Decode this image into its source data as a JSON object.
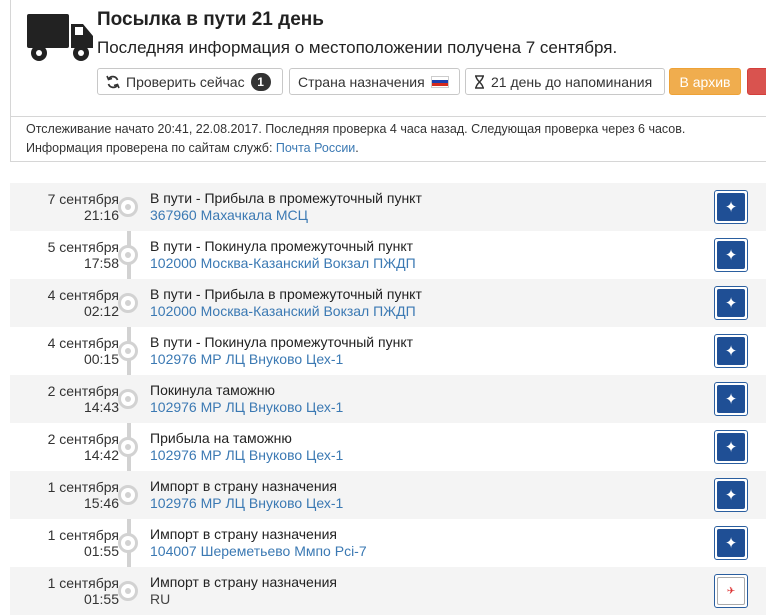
{
  "header": {
    "title": "Посылка в пути 21 день",
    "subtitle": "Последняя информация о местоположении получена 7 сентября.",
    "truck_icon": "truck-icon",
    "buttons": {
      "check_label": "Проверить сейчас",
      "check_badge": "1",
      "country_label": "Страна назначения",
      "remind_label": "21 день до напоминания",
      "archive_label": "В архив"
    }
  },
  "info": {
    "line1": "Отслеживание начато 20:41, 22.08.2017. Последняя проверка 4 часа назад. Следующая проверка через 6 часов.",
    "line2_prefix": "Информация проверена по сайтам служб: ",
    "line2_link": "Почта России",
    "line2_suffix": "."
  },
  "colors": {
    "link": "#3b79b3",
    "archive": "#f0ad4e",
    "danger": "#d9534f",
    "russian_post": "#1f4f95"
  },
  "events": [
    {
      "date": "7 сентября",
      "time": "21:16",
      "status": "В пути - Прибыла в промежуточный пункт",
      "place": "367960 Махачкала МСЦ",
      "service": "russian-post-logo"
    },
    {
      "date": "5 сентября",
      "time": "17:58",
      "status": "В пути - Покинула промежуточный пункт",
      "place": "102000 Москва-Казанский Вокзал ПЖДП",
      "service": "russian-post-logo"
    },
    {
      "date": "4 сентября",
      "time": "02:12",
      "status": "В пути - Прибыла в промежуточный пункт",
      "place": "102000 Москва-Казанский Вокзал ПЖДП",
      "service": "russian-post-logo"
    },
    {
      "date": "4 сентября",
      "time": "00:15",
      "status": "В пути - Покинула промежуточный пункт",
      "place": "102976 МР ЛЦ Внуково Цех-1",
      "service": "russian-post-logo"
    },
    {
      "date": "2 сентября",
      "time": "14:43",
      "status": "Покинула таможню",
      "place": "102976 МР ЛЦ Внуково Цех-1",
      "service": "russian-post-logo"
    },
    {
      "date": "2 сентября",
      "time": "14:42",
      "status": "Прибыла на таможню",
      "place": "102976 МР ЛЦ Внуково Цех-1",
      "service": "russian-post-logo"
    },
    {
      "date": "1 сентября",
      "time": "15:46",
      "status": "Импорт в страну назначения",
      "place": "102976 МР ЛЦ Внуково Цех-1",
      "service": "russian-post-logo"
    },
    {
      "date": "1 сентября",
      "time": "01:55",
      "status": "Импорт в страну назначения",
      "place": "104007 Шереметьево Ммпо Pci-7",
      "service": "russian-post-logo"
    },
    {
      "date": "1 сентября",
      "time": "01:55",
      "status": "Импорт в страну назначения",
      "place": "RU",
      "service": "carrier-logo"
    }
  ]
}
